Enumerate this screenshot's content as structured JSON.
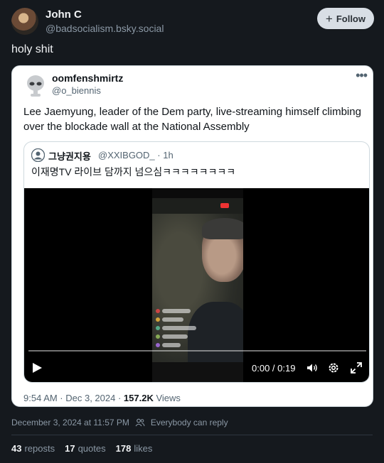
{
  "post": {
    "author_name": "John C",
    "author_handle": "@badsocialism.bsky.social",
    "follow_label": "Follow",
    "text": "holy shit",
    "date": "December 3, 2024 at 11:57 PM",
    "reply_setting": "Everybody can reply",
    "reposts_count": "43",
    "reposts_label": "reposts",
    "quotes_count": "17",
    "quotes_label": "quotes",
    "likes_count": "178",
    "likes_label": "likes"
  },
  "embed": {
    "author_name": "oomfenshmirtz",
    "author_handle": "@o_biennis",
    "text": "Lee Jaemyung, leader of the Dem party, live-streaming himself climbing over the blockade wall at the National Assembly",
    "timestamp": "9:54 AM · Dec 3, 2024 · ",
    "views_count": "157.2K",
    "views_label": " Views",
    "quoted": {
      "author_name": "그냥권지용",
      "author_handle": "@XXIBGOD_ · 1h",
      "text": "이재명TV 라이브 담까지 넘으심ㅋㅋㅋㅋㅋㅋㅋㅋ"
    },
    "video": {
      "time": "0:00 / 0:19",
      "progress": 0,
      "icons": [
        "play-icon",
        "volume-icon",
        "settings-icon",
        "fullscreen-icon"
      ]
    }
  },
  "colors": {
    "background": "#15191e",
    "follow_button": "#d8dee5",
    "muted_text": "#8b98a5"
  }
}
